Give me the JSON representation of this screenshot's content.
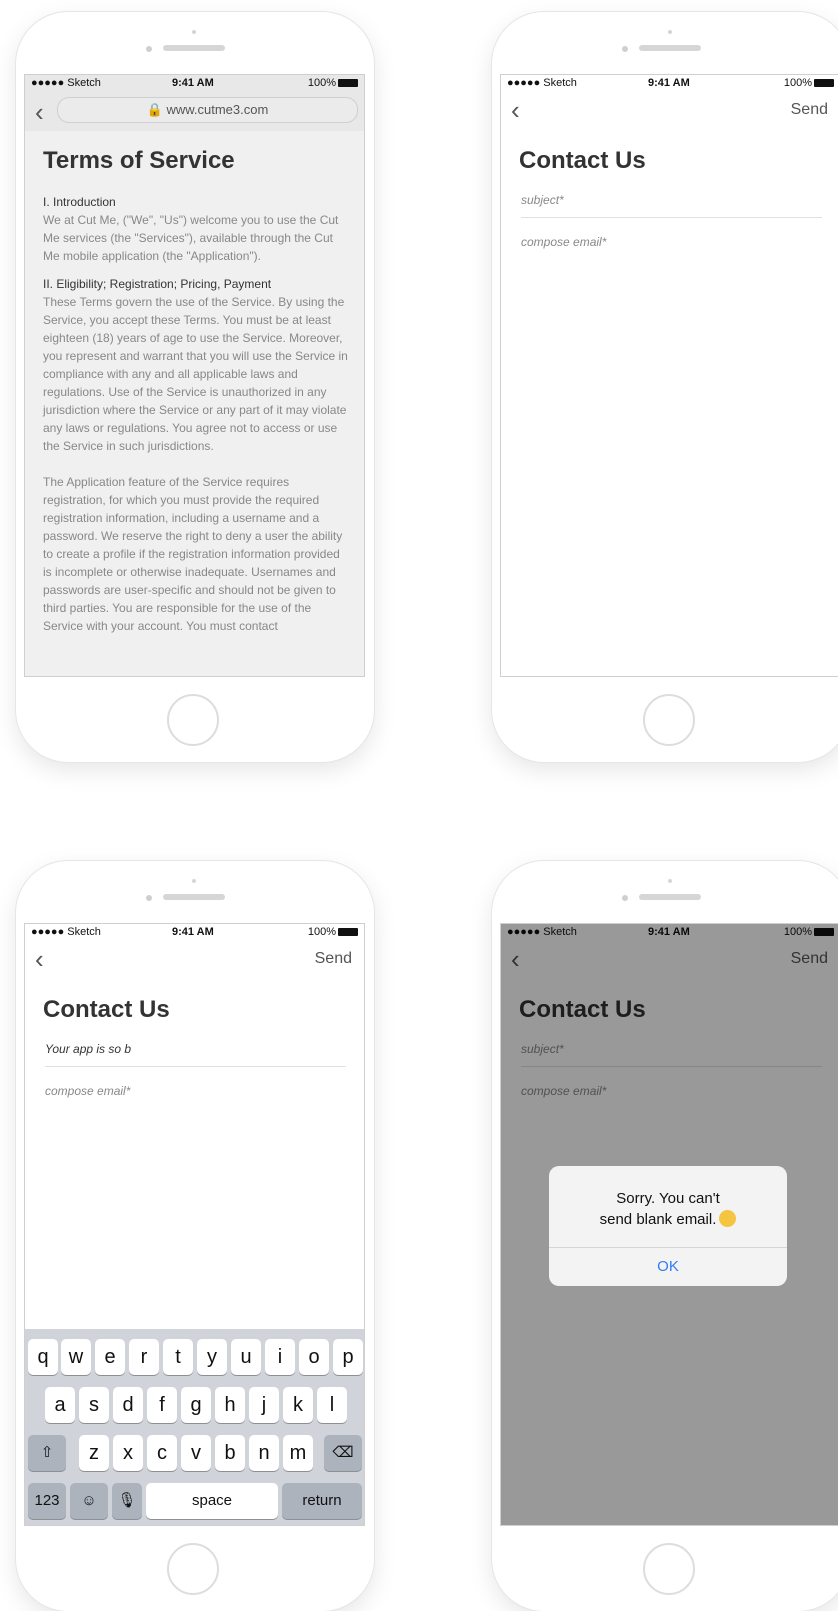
{
  "status": {
    "carrier": "●●●●● Sketch",
    "wifi": "ᯤ",
    "time": "9:41 AM",
    "battery": "100%"
  },
  "terms": {
    "url": "🔒 www.cutme3.com",
    "title": "Terms of Service",
    "s1_heading": "I. Introduction",
    "s1_body": "We at Cut Me, (\"We\", \"Us\") welcome you to use the Cut Me services (the \"Services\"), available through the Cut Me mobile application (the \"Application\").",
    "s2_heading": "II. Eligibility; Registration; Pricing, Payment",
    "s2_body": "These Terms govern the use of the Service. By using the Service, you accept these Terms. You must be at least eighteen (18) years of age to use the Service. Moreover, you represent and warrant that you will use the Service in compliance with any and all applicable laws and regulations. Use of the Service is unauthorized in any jurisdiction where the Service or any part of it may violate any laws or regulations. You agree not to access or use the Service in such jurisdictions.",
    "s3_body": "The Application feature of the Service requires registration, for which you must provide the required registration information, including a username and a password. We reserve the right to deny a user the ability to create a profile if the registration information provided is incomplete or otherwise inadequate. Usernames and passwords are user-specific and should not be given to third parties. You are responsible for the use of the Service with your account. You must contact"
  },
  "contact": {
    "title": "Contact Us",
    "send": "Send",
    "back": "‹",
    "subject_placeholder": "subject*",
    "compose_placeholder": "compose email*",
    "typed_subject": "Your app is so b"
  },
  "keyboard": {
    "row1": [
      "q",
      "w",
      "e",
      "r",
      "t",
      "y",
      "u",
      "i",
      "o",
      "p"
    ],
    "row2": [
      "a",
      "s",
      "d",
      "f",
      "g",
      "h",
      "j",
      "k",
      "l"
    ],
    "row3": [
      "z",
      "x",
      "c",
      "v",
      "b",
      "n",
      "m"
    ],
    "shift": "⇧",
    "delete": "⌫",
    "num": "123",
    "emoji": "☺",
    "mic": "🎙",
    "space": "space",
    "return": "return"
  },
  "alert": {
    "line1": "Sorry. You can't",
    "line2": "send blank email.",
    "ok": "OK"
  }
}
